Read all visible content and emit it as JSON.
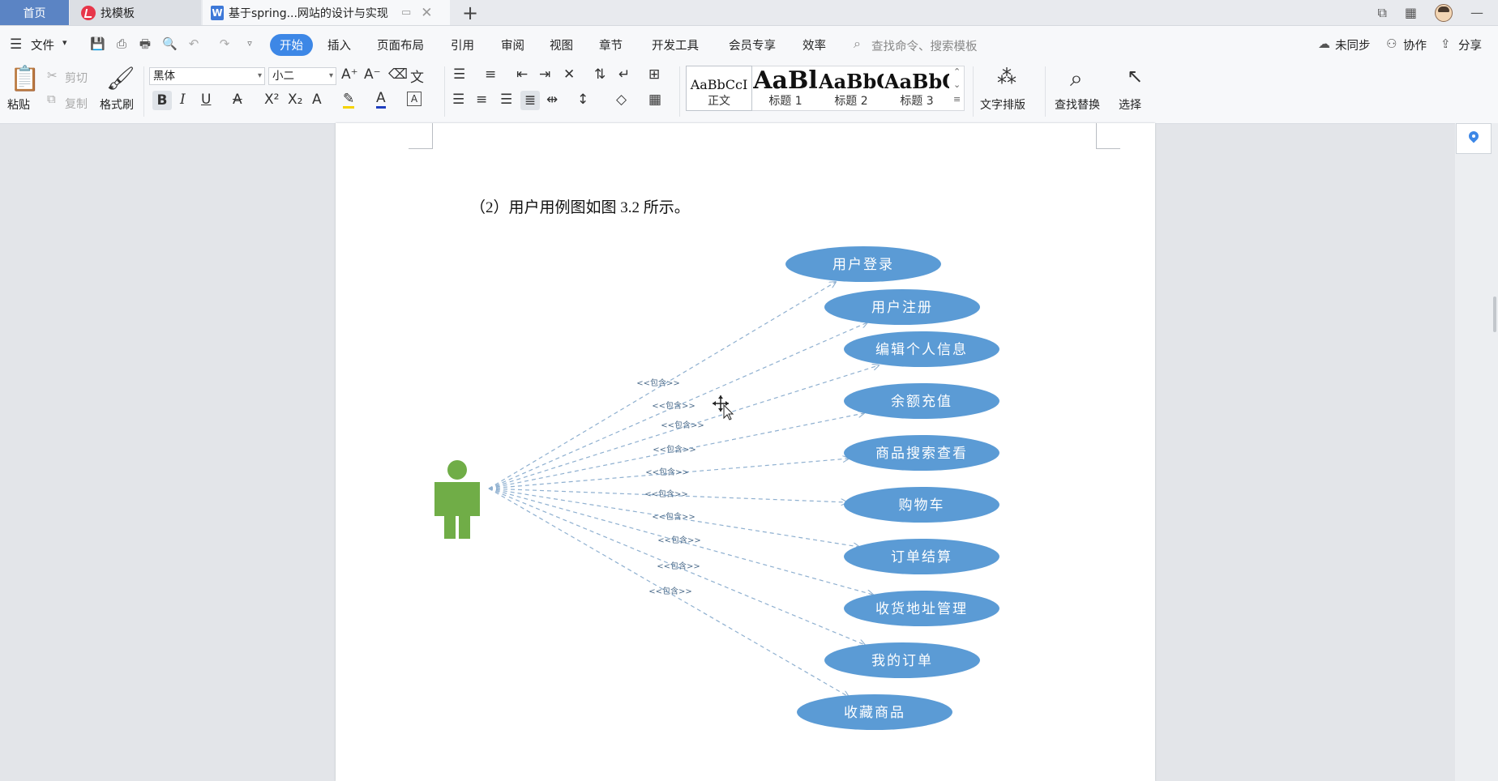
{
  "tabs": {
    "home": "首页",
    "templates": "找模板",
    "document": "基于spring...网站的设计与实现"
  },
  "menu": {
    "file": "文件",
    "active": "开始",
    "items": [
      "插入",
      "页面布局",
      "引用",
      "审阅",
      "视图",
      "章节",
      "开发工具",
      "会员专享",
      "效率"
    ],
    "search_placeholder": "查找命令、搜索模板",
    "sync": "未同步",
    "collab": "协作",
    "share": "分享"
  },
  "ribbon": {
    "paste": "粘贴",
    "cut": "剪切",
    "copy": "复制",
    "format_painter": "格式刷",
    "font_name": "黑体",
    "font_size": "小二",
    "styles": [
      {
        "preview": "AaBbCcI",
        "label": "正文"
      },
      {
        "preview": "AaBl",
        "label": "标题 1"
      },
      {
        "preview": "AaBbC",
        "label": "标题 2"
      },
      {
        "preview": "AaBbC",
        "label": "标题 3"
      }
    ],
    "text_layout": "文字排版",
    "find_replace": "查找替换",
    "select": "选择"
  },
  "document": {
    "caption": "（2）用户用例图如图 3.2 所示。",
    "include_label": "<<包含>>",
    "use_cases": [
      "用户登录",
      "用户注册",
      "编辑个人信息",
      "余额充值",
      "商品搜索查看",
      "购物车",
      "订单结算",
      "收货地址管理",
      "我的订单",
      "收藏商品"
    ]
  },
  "colors": {
    "accent": "#3d87e6",
    "home_tab": "#5b84c4",
    "use_case_fill": "#5b9bd5",
    "actor_fill": "#70ad47",
    "include_line": "#8fb0d0"
  }
}
